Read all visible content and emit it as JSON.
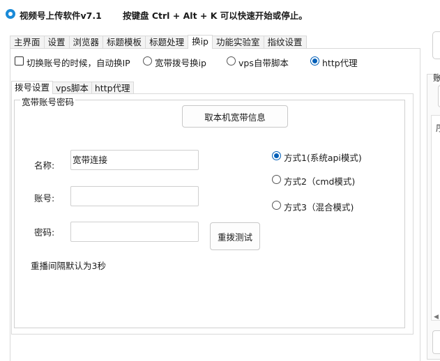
{
  "window": {
    "title": "视频号上传软件v7.1",
    "hotkey_hint": "按键盘 Ctrl + Alt + K  可以快速开始或停止。"
  },
  "main_tabs": [
    {
      "label": "主界面",
      "active": false
    },
    {
      "label": "设置",
      "active": false
    },
    {
      "label": "浏览器",
      "active": false
    },
    {
      "label": "标题模板",
      "active": false
    },
    {
      "label": "标题处理",
      "active": false
    },
    {
      "label": "换ip",
      "active": true
    },
    {
      "label": "功能实验室",
      "active": false
    },
    {
      "label": "指纹设置",
      "active": false
    }
  ],
  "ip_options": {
    "switch_on_account_change": {
      "label": "切换账号的时候，自动换IP",
      "checked": false
    },
    "modes": [
      {
        "label": "宽带拨号换ip",
        "selected": false
      },
      {
        "label": "vps自带脚本",
        "selected": false
      },
      {
        "label": "http代理",
        "selected": true
      }
    ]
  },
  "sub_tabs": [
    {
      "label": "拨号设置",
      "active": true
    },
    {
      "label": "vps脚本",
      "active": false
    },
    {
      "label": "http代理",
      "active": false
    }
  ],
  "dial_settings": {
    "group_title": "宽带账号密码",
    "get_local_info_button": "取本机宽带信息",
    "name_label": "名称:",
    "name_value": "宽带连接",
    "account_label": "账号:",
    "account_value": "",
    "password_label": "密码:",
    "password_value": "",
    "redial_test_button": "重拨测试",
    "interval_note": "重播间隔默认为3秒",
    "methods": [
      {
        "label": "方式1(系统api模式)",
        "selected": true
      },
      {
        "label": "方式2（cmd模式)",
        "selected": false
      },
      {
        "label": "方式3（混合模式)",
        "selected": false
      }
    ]
  },
  "right_panel": {
    "header_fragment": "账",
    "column_fragment": "序"
  },
  "colors": {
    "accent": "#005fb8",
    "border": "#d9d9d9",
    "tab_inactive": "#f3f3f3"
  }
}
